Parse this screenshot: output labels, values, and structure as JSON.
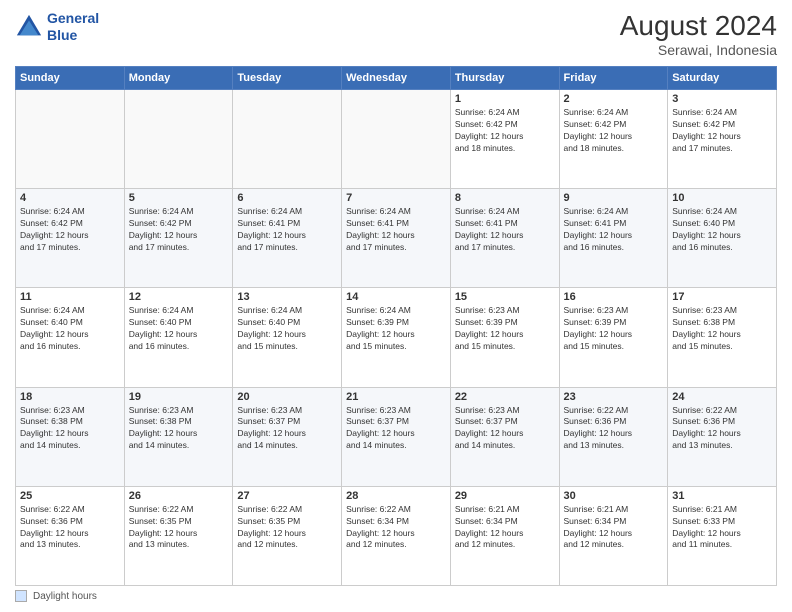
{
  "header": {
    "logo_line1": "General",
    "logo_line2": "Blue",
    "month_year": "August 2024",
    "location": "Serawai, Indonesia"
  },
  "legend": {
    "box_label": "Daylight hours"
  },
  "days_of_week": [
    "Sunday",
    "Monday",
    "Tuesday",
    "Wednesday",
    "Thursday",
    "Friday",
    "Saturday"
  ],
  "weeks": [
    [
      {
        "day": "",
        "info": ""
      },
      {
        "day": "",
        "info": ""
      },
      {
        "day": "",
        "info": ""
      },
      {
        "day": "",
        "info": ""
      },
      {
        "day": "1",
        "info": "Sunrise: 6:24 AM\nSunset: 6:42 PM\nDaylight: 12 hours\nand 18 minutes."
      },
      {
        "day": "2",
        "info": "Sunrise: 6:24 AM\nSunset: 6:42 PM\nDaylight: 12 hours\nand 18 minutes."
      },
      {
        "day": "3",
        "info": "Sunrise: 6:24 AM\nSunset: 6:42 PM\nDaylight: 12 hours\nand 17 minutes."
      }
    ],
    [
      {
        "day": "4",
        "info": "Sunrise: 6:24 AM\nSunset: 6:42 PM\nDaylight: 12 hours\nand 17 minutes."
      },
      {
        "day": "5",
        "info": "Sunrise: 6:24 AM\nSunset: 6:42 PM\nDaylight: 12 hours\nand 17 minutes."
      },
      {
        "day": "6",
        "info": "Sunrise: 6:24 AM\nSunset: 6:41 PM\nDaylight: 12 hours\nand 17 minutes."
      },
      {
        "day": "7",
        "info": "Sunrise: 6:24 AM\nSunset: 6:41 PM\nDaylight: 12 hours\nand 17 minutes."
      },
      {
        "day": "8",
        "info": "Sunrise: 6:24 AM\nSunset: 6:41 PM\nDaylight: 12 hours\nand 17 minutes."
      },
      {
        "day": "9",
        "info": "Sunrise: 6:24 AM\nSunset: 6:41 PM\nDaylight: 12 hours\nand 16 minutes."
      },
      {
        "day": "10",
        "info": "Sunrise: 6:24 AM\nSunset: 6:40 PM\nDaylight: 12 hours\nand 16 minutes."
      }
    ],
    [
      {
        "day": "11",
        "info": "Sunrise: 6:24 AM\nSunset: 6:40 PM\nDaylight: 12 hours\nand 16 minutes."
      },
      {
        "day": "12",
        "info": "Sunrise: 6:24 AM\nSunset: 6:40 PM\nDaylight: 12 hours\nand 16 minutes."
      },
      {
        "day": "13",
        "info": "Sunrise: 6:24 AM\nSunset: 6:40 PM\nDaylight: 12 hours\nand 15 minutes."
      },
      {
        "day": "14",
        "info": "Sunrise: 6:24 AM\nSunset: 6:39 PM\nDaylight: 12 hours\nand 15 minutes."
      },
      {
        "day": "15",
        "info": "Sunrise: 6:23 AM\nSunset: 6:39 PM\nDaylight: 12 hours\nand 15 minutes."
      },
      {
        "day": "16",
        "info": "Sunrise: 6:23 AM\nSunset: 6:39 PM\nDaylight: 12 hours\nand 15 minutes."
      },
      {
        "day": "17",
        "info": "Sunrise: 6:23 AM\nSunset: 6:38 PM\nDaylight: 12 hours\nand 15 minutes."
      }
    ],
    [
      {
        "day": "18",
        "info": "Sunrise: 6:23 AM\nSunset: 6:38 PM\nDaylight: 12 hours\nand 14 minutes."
      },
      {
        "day": "19",
        "info": "Sunrise: 6:23 AM\nSunset: 6:38 PM\nDaylight: 12 hours\nand 14 minutes."
      },
      {
        "day": "20",
        "info": "Sunrise: 6:23 AM\nSunset: 6:37 PM\nDaylight: 12 hours\nand 14 minutes."
      },
      {
        "day": "21",
        "info": "Sunrise: 6:23 AM\nSunset: 6:37 PM\nDaylight: 12 hours\nand 14 minutes."
      },
      {
        "day": "22",
        "info": "Sunrise: 6:23 AM\nSunset: 6:37 PM\nDaylight: 12 hours\nand 14 minutes."
      },
      {
        "day": "23",
        "info": "Sunrise: 6:22 AM\nSunset: 6:36 PM\nDaylight: 12 hours\nand 13 minutes."
      },
      {
        "day": "24",
        "info": "Sunrise: 6:22 AM\nSunset: 6:36 PM\nDaylight: 12 hours\nand 13 minutes."
      }
    ],
    [
      {
        "day": "25",
        "info": "Sunrise: 6:22 AM\nSunset: 6:36 PM\nDaylight: 12 hours\nand 13 minutes."
      },
      {
        "day": "26",
        "info": "Sunrise: 6:22 AM\nSunset: 6:35 PM\nDaylight: 12 hours\nand 13 minutes."
      },
      {
        "day": "27",
        "info": "Sunrise: 6:22 AM\nSunset: 6:35 PM\nDaylight: 12 hours\nand 12 minutes."
      },
      {
        "day": "28",
        "info": "Sunrise: 6:22 AM\nSunset: 6:34 PM\nDaylight: 12 hours\nand 12 minutes."
      },
      {
        "day": "29",
        "info": "Sunrise: 6:21 AM\nSunset: 6:34 PM\nDaylight: 12 hours\nand 12 minutes."
      },
      {
        "day": "30",
        "info": "Sunrise: 6:21 AM\nSunset: 6:34 PM\nDaylight: 12 hours\nand 12 minutes."
      },
      {
        "day": "31",
        "info": "Sunrise: 6:21 AM\nSunset: 6:33 PM\nDaylight: 12 hours\nand 11 minutes."
      }
    ]
  ]
}
